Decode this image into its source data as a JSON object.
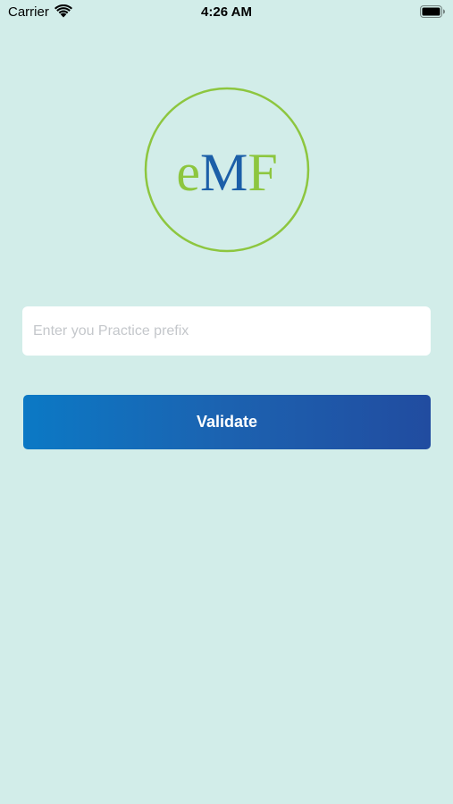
{
  "status_bar": {
    "carrier": "Carrier",
    "time": "4:26 AM",
    "wifi_icon": "wifi-icon",
    "battery_icon": "battery-icon"
  },
  "logo": {
    "text_e": "e",
    "text_m": "M",
    "text_f": "F",
    "ring_color": "#8dc63f",
    "green_color": "#8dc63f",
    "blue_color": "#1c5fa8"
  },
  "form": {
    "prefix_placeholder": "Enter you Practice prefix",
    "prefix_value": "",
    "validate_label": "Validate"
  },
  "colors": {
    "background": "#d2ede9",
    "button_gradient_start": "#0b79c5",
    "button_gradient_end": "#214ca0"
  }
}
